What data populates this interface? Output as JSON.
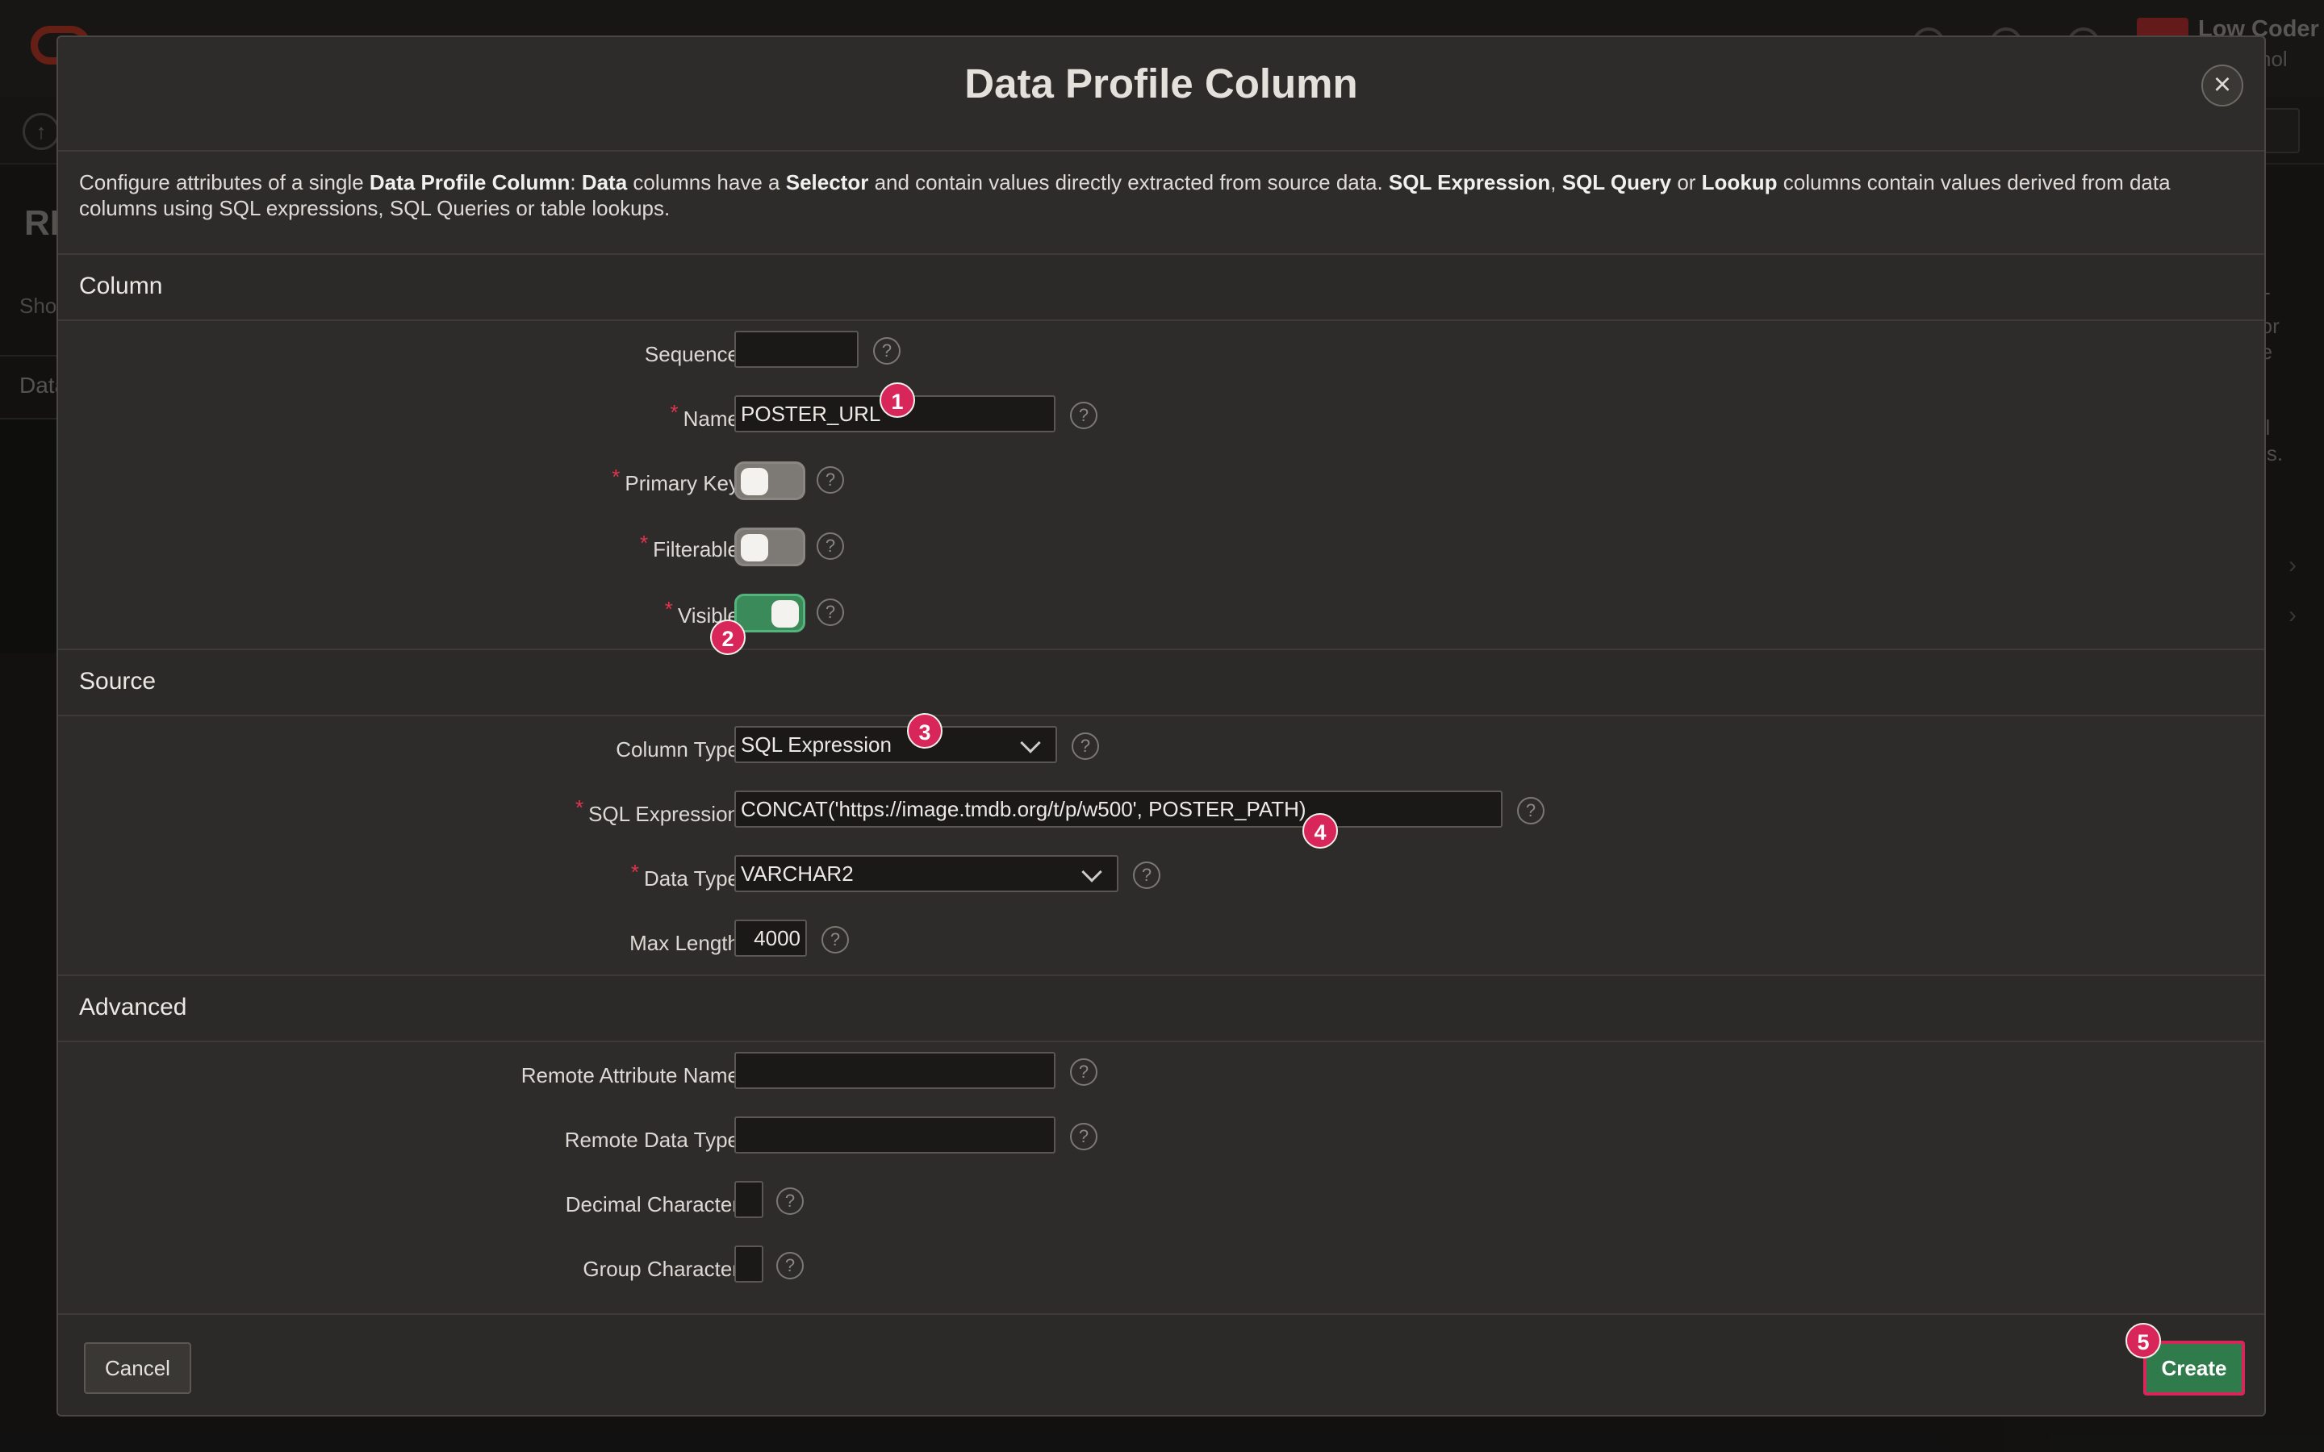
{
  "background": {
    "page_title_fragment": "RE",
    "show_fragment": "Show",
    "tab_fragment": "Data",
    "user_name": "Low Coder",
    "user_sub": "hol",
    "right_panel_lines": [
      "ST",
      "e or",
      "the",
      "vel",
      "ons."
    ]
  },
  "dialog": {
    "title": "Data Profile Column",
    "close_label": "×",
    "description": {
      "p1": "Configure attributes of a single ",
      "b1": "Data Profile Column",
      "p2": ": ",
      "b2": "Data",
      "p3": " columns have a ",
      "b3": "Selector",
      "p4": " and contain values directly extracted from source data. ",
      "b4": "SQL Expression",
      "p5": ", ",
      "b5": "SQL Query",
      "p6": " or ",
      "b6": "Lookup",
      "p7": " columns contain values derived from data columns using SQL expressions, SQL Queries or table lookups."
    },
    "sections": {
      "column": "Column",
      "source": "Source",
      "advanced": "Advanced"
    },
    "fields": {
      "sequence": {
        "label": "Sequence",
        "value": ""
      },
      "name": {
        "label": "Name",
        "value": "POSTER_URL",
        "required": "*"
      },
      "primary_key": {
        "label": "Primary Key",
        "required": "*",
        "on": false
      },
      "filterable": {
        "label": "Filterable",
        "required": "*",
        "on": false
      },
      "visible": {
        "label": "Visible",
        "required": "*",
        "on": true
      },
      "column_type": {
        "label": "Column Type",
        "value": "SQL Expression"
      },
      "sql_expression": {
        "label": "SQL Expression",
        "required": "*",
        "value": "CONCAT('https://image.tmdb.org/t/p/w500', POSTER_PATH)"
      },
      "data_type": {
        "label": "Data Type",
        "required": "*",
        "value": "VARCHAR2"
      },
      "max_length": {
        "label": "Max Length",
        "value": "4000"
      },
      "remote_attribute_name": {
        "label": "Remote Attribute Name",
        "value": ""
      },
      "remote_data_type": {
        "label": "Remote Data Type",
        "value": ""
      },
      "decimal_character": {
        "label": "Decimal Character",
        "value": ""
      },
      "group_character": {
        "label": "Group Character",
        "value": ""
      }
    },
    "help_glyph": "?",
    "footer": {
      "cancel_label": "Cancel",
      "create_label": "Create"
    }
  },
  "step_badges": [
    "1",
    "2",
    "3",
    "4",
    "5"
  ],
  "colors": {
    "accent_green": "#2f7b4c",
    "toggle_on": "#3a8a5a",
    "required_star": "#e0344e",
    "badge": "#d8255a"
  },
  "icons": [
    "close-icon",
    "help-icon",
    "chevron-down-icon",
    "toggle-switch"
  ]
}
